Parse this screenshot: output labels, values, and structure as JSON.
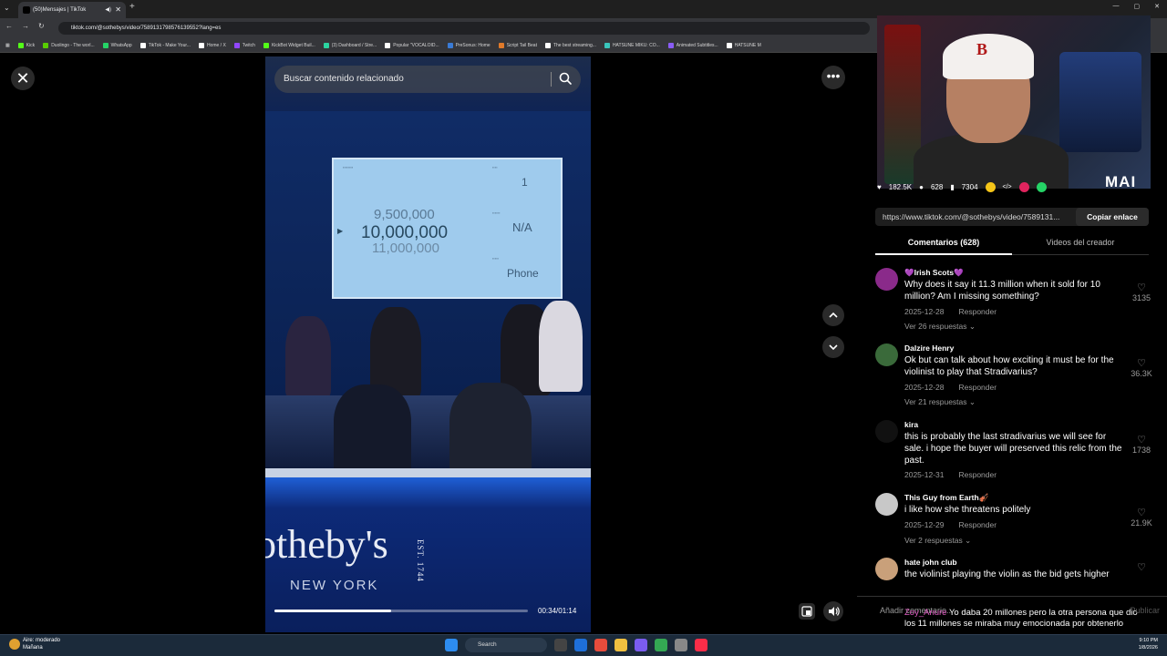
{
  "browser": {
    "tab_title": "(50)Mensajes | TikTok",
    "url": "tiktok.com/@sothebys/video/7589131798576139552?lang=es",
    "bookmarks": [
      {
        "label": "Kick",
        "color": "#53fc18"
      },
      {
        "label": "Duolingo - The worl...",
        "color": "#58cc02"
      },
      {
        "label": "WhatsApp",
        "color": "#25d366"
      },
      {
        "label": "TikTok - Make Your...",
        "color": "#ffffff"
      },
      {
        "label": "Home / X",
        "color": "#ffffff"
      },
      {
        "label": "Twitch",
        "color": "#9146ff"
      },
      {
        "label": "KickBot Widget Buil...",
        "color": "#53fc18"
      },
      {
        "label": "(3) Dashboard / Stre...",
        "color": "#2bd4a0"
      },
      {
        "label": "Popular \"VOCALOID...",
        "color": "#ffffff"
      },
      {
        "label": "PreSonus: Home",
        "color": "#3a7bd5"
      },
      {
        "label": "Script Tail Beat",
        "color": "#e07a2a"
      },
      {
        "label": "The best streaming...",
        "color": "#ffffff"
      },
      {
        "label": "HATSUNE MIKU: CO...",
        "color": "#39c5bb"
      },
      {
        "label": "Animated Subtitles...",
        "color": "#8a5cf6"
      },
      {
        "label": "HATSUNE M",
        "color": "#ffffff"
      }
    ]
  },
  "player": {
    "search_placeholder": "Buscar contenido relacionado",
    "time": "00:34/01:14",
    "progress": 0.46,
    "close_icon": "close-icon",
    "more_icon": "more-icon"
  },
  "video": {
    "screen_prev": "9,500,000",
    "screen_current": "10,000,000",
    "screen_next": "11,000,000",
    "screen_lot": "1",
    "screen_na": "N/A",
    "screen_phone": "Phone",
    "brand": "otheby's",
    "est": "EST. 1744",
    "city": "NEW YORK"
  },
  "overlay": {
    "logo": "MAI"
  },
  "stats": {
    "likes": "182.5K",
    "comments": "628",
    "saves": "7304"
  },
  "share": {
    "url": "https://www.tiktok.com/@sothebys/video/7589131...",
    "copy_label": "Copiar enlace"
  },
  "tabs": {
    "comments": "Comentarios (628)",
    "creator": "Videos del creador"
  },
  "comments": [
    {
      "user": "💜Irish Scots💜",
      "text": "Why does it say it 11.3 million when it sold for 10 million? Am I missing something?",
      "date": "2025-12-28",
      "reply": "Responder",
      "replies": "Ver 26 respuestas ⌄",
      "likes": "3135",
      "avatar": "#8a2a8a"
    },
    {
      "user": "Dalzire Henry",
      "text": "Ok but can talk about how exciting it must be for the violinist to play that Stradivarius?",
      "date": "2025-12-28",
      "reply": "Responder",
      "replies": "Ver 21 respuestas ⌄",
      "likes": "36.3K",
      "avatar": "#3a6a3a"
    },
    {
      "user": "kira",
      "text": "this is probably the last stradivarius we will see for sale. i hope the buyer will preserved this relic from the past.",
      "date": "2025-12-31",
      "reply": "Responder",
      "replies": "",
      "likes": "1738",
      "avatar": "#111111"
    },
    {
      "user": "This Guy from Earth🎻",
      "text": "i like how she threatens politely",
      "date": "2025-12-29",
      "reply": "Responder",
      "replies": "Ver 2 respuestas ⌄",
      "likes": "21.9K",
      "avatar": "#c8c8c8"
    },
    {
      "user": "hate john club",
      "text": "the violinist playing the violin as the bid gets higher",
      "date": "",
      "reply": "",
      "replies": "",
      "likes": "",
      "avatar": "#c9a07a"
    }
  ],
  "compose": {
    "placeholder": "Añadir comentario...",
    "chat_user": "Zoy_Anure",
    "chat_text": "Yo daba 20 millones pero la otra persona que dio los 11 millones se miraba muy emocionada por obtenerlo",
    "publish": "Publicar"
  },
  "taskbar": {
    "weather_title": "Aire: moderado",
    "weather_sub": "Mañana",
    "search": "Search",
    "time": "9:10 PM",
    "date": "1/8/2026"
  }
}
